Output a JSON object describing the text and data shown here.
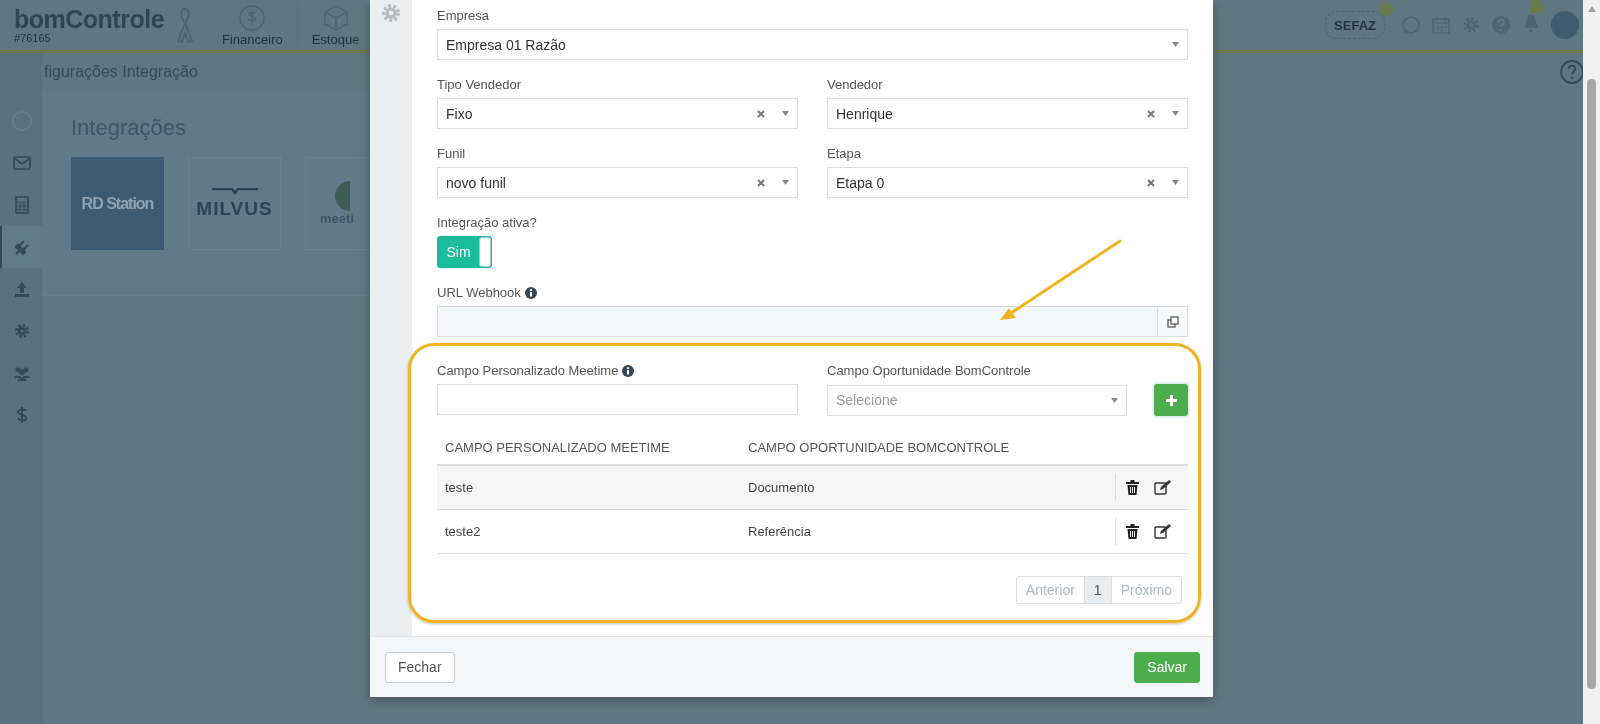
{
  "app": {
    "logo": "bomControle",
    "account": "#76165",
    "nav": [
      {
        "label": "Financeiro",
        "kind": "money"
      },
      {
        "label": "Estoque",
        "kind": "box"
      }
    ],
    "sefaz": "SEFAZ",
    "breadcrumb": "figurações Integração"
  },
  "sidebar": [
    {
      "kind": "circle",
      "selected": false
    },
    {
      "kind": "mail",
      "selected": false
    },
    {
      "kind": "calculator",
      "selected": false
    },
    {
      "kind": "plug",
      "selected": true
    },
    {
      "kind": "upload",
      "selected": false
    },
    {
      "kind": "gear",
      "selected": false
    },
    {
      "kind": "users",
      "selected": false
    },
    {
      "kind": "dollar",
      "selected": false
    }
  ],
  "page": {
    "title": "Integrações",
    "tiles": [
      {
        "label": "RD Station",
        "kind": "rd"
      },
      {
        "label": "MILVUS",
        "kind": "milvus"
      },
      {
        "label": "meeti",
        "kind": "meetime"
      }
    ]
  },
  "modal": {
    "field_rows": [
      {
        "fields": [
          {
            "label": "Empresa",
            "value": "Empresa 01 Razão",
            "clearable": false
          }
        ]
      },
      {
        "fields": [
          {
            "label": "Tipo Vendedor",
            "value": "Fixo",
            "clearable": true
          },
          {
            "label": "Vendedor",
            "value": "Henrique",
            "clearable": true
          }
        ]
      },
      {
        "fields": [
          {
            "label": "Funil",
            "value": "novo funil",
            "clearable": true
          },
          {
            "label": "Etapa",
            "value": "Etapa 0",
            "clearable": true
          }
        ]
      }
    ],
    "toggle": {
      "label": "Integração ativa?",
      "text": "Sim",
      "on": true
    },
    "webhook": {
      "label": "URL Webhook"
    },
    "custom_field": {
      "label": "Campo Personalizado Meetime"
    },
    "opportunity_field": {
      "label": "Campo Oportunidade BomControle",
      "placeholder": "Selecione"
    },
    "table": {
      "columns": [
        "CAMPO PERSONALIZADO MEETIME",
        "CAMPO OPORTUNIDADE BOMCONTROLE"
      ],
      "rows": [
        {
          "cells": [
            "teste",
            "Documento"
          ]
        },
        {
          "cells": [
            "teste2",
            "Referência"
          ]
        }
      ]
    },
    "pagination": [
      {
        "label": "Anterior",
        "selected": false,
        "disabled": true
      },
      {
        "label": "1",
        "selected": true,
        "disabled": false
      },
      {
        "label": "Próximo",
        "selected": false,
        "disabled": true
      }
    ],
    "buttons": [
      {
        "label": "Fechar",
        "kind": "default"
      },
      {
        "label": "Salvar",
        "kind": "primary"
      }
    ]
  }
}
